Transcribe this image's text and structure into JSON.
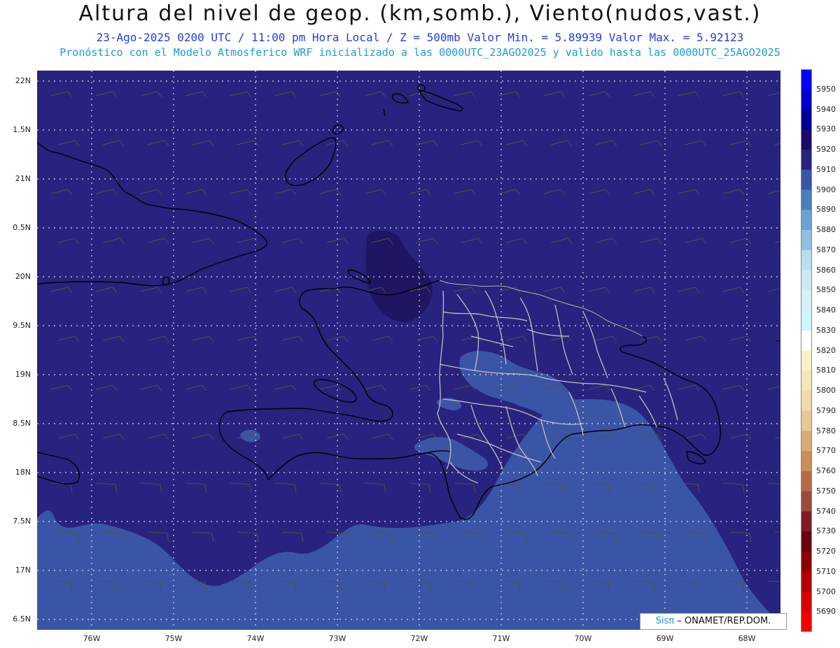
{
  "title": {
    "main": "Altura del nivel de geop. (km,somb.), Viento(nudos,vast.)",
    "line2": "23-Ago-2025  0200 UTC / 11:00 pm Hora Local / Z = 500mb   Valor Min. = 5.89939  Valor Max. = 5.92123",
    "line3": "Pronóstico con el Modelo Atmosferico WRF inicializado a las 0000UTC_23AGO2025 y valido hasta las  0000UTC_25AGO2025"
  },
  "map": {
    "lat_labels": [
      "22N",
      "1.5N",
      "21N",
      "0.5N",
      "20N",
      "9.5N",
      "19N",
      "8.5N",
      "18N",
      "7.5N",
      "17N",
      "6.5N"
    ],
    "lon_labels": [
      "76W",
      "75W",
      "74W",
      "73W",
      "72W",
      "71W",
      "70W",
      "69W",
      "68W"
    ],
    "colors": {
      "background_fill": "#27237e",
      "high_fill": "#211866",
      "low_fill": "#3a55a6",
      "coast": "#000000",
      "borders": "#bfbfbf",
      "grid": "#dcdcdc",
      "barbs": "#505050"
    }
  },
  "colorbar": {
    "levels": [
      "5950",
      "5940",
      "5930",
      "5920",
      "5910",
      "5900",
      "5890",
      "5880",
      "5870",
      "5860",
      "5850",
      "5840",
      "5830",
      "5820",
      "5810",
      "5800",
      "5790",
      "5780",
      "5770",
      "5760",
      "5750",
      "5740",
      "5730",
      "5720",
      "5710",
      "5700",
      "5690"
    ],
    "colors": [
      "#0000ff",
      "#0000cc",
      "#000099",
      "#1a0a6a",
      "#27237e",
      "#3a55a6",
      "#4a7ebd",
      "#6aa1d2",
      "#8fc0e2",
      "#b7dff0",
      "#cfe9f3",
      "#d6f1f6",
      "#ccf7fb",
      "#ffffff",
      "#f8f0c8",
      "#f3e6b8",
      "#efdbaa",
      "#e6c896",
      "#d9aa75",
      "#c98d5b",
      "#b56a45",
      "#9c4a38",
      "#7e1b25",
      "#6b0010",
      "#8c0000",
      "#b30000",
      "#d60000",
      "#f00000"
    ]
  },
  "credit": {
    "logo": "Sisπ",
    "text": "– ONAMET/REP.DOM."
  }
}
